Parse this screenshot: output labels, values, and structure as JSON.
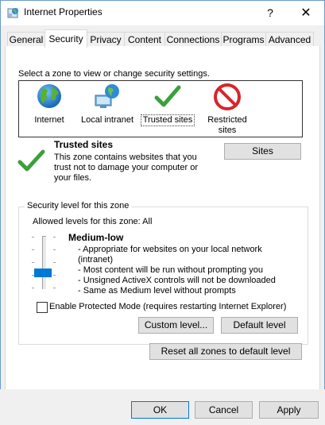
{
  "window": {
    "title": "Internet Properties",
    "help_label": "?",
    "close_label": "✕"
  },
  "tabs": [
    {
      "label": "General"
    },
    {
      "label": "Security"
    },
    {
      "label": "Privacy"
    },
    {
      "label": "Content"
    },
    {
      "label": "Connections"
    },
    {
      "label": "Programs"
    },
    {
      "label": "Advanced"
    }
  ],
  "active_tab": "Security",
  "zones": {
    "prompt": "Select a zone to view or change security settings.",
    "items": [
      {
        "label": "Internet",
        "icon": "globe-icon"
      },
      {
        "label": "Local intranet",
        "icon": "network-icon"
      },
      {
        "label": "Trusted sites",
        "icon": "checkmark-icon"
      },
      {
        "label": "Restricted sites",
        "icon": "no-entry-icon"
      }
    ],
    "selected": "Trusted sites"
  },
  "zone_info": {
    "title": "Trusted sites",
    "desc_lines": [
      "This zone contains websites that you",
      "trust not to damage your computer or",
      "your files."
    ],
    "sites_button": "Sites"
  },
  "security_level": {
    "group_title": "Security level for this zone",
    "allowed": "Allowed levels for this zone: All",
    "level_name": "Medium-low",
    "level_fraction": 0.25,
    "desc_lines": [
      "- Appropriate for websites on your local network",
      "(intranet)",
      "- Most content will be run without prompting you",
      "- Unsigned ActiveX controls will not be downloaded",
      "- Same as Medium level without prompts"
    ],
    "protected_mode_label": "Enable Protected Mode (requires restarting Internet Explorer)",
    "protected_mode_checked": false,
    "custom_level_button": "Custom level...",
    "default_level_button": "Default level"
  },
  "reset_button": "Reset all zones to default level",
  "footer": {
    "ok": "OK",
    "cancel": "Cancel",
    "apply": "Apply"
  },
  "colors": {
    "accent": "#0078d7",
    "check_green": "#3aa13a",
    "restricted_red": "#d7262b"
  }
}
